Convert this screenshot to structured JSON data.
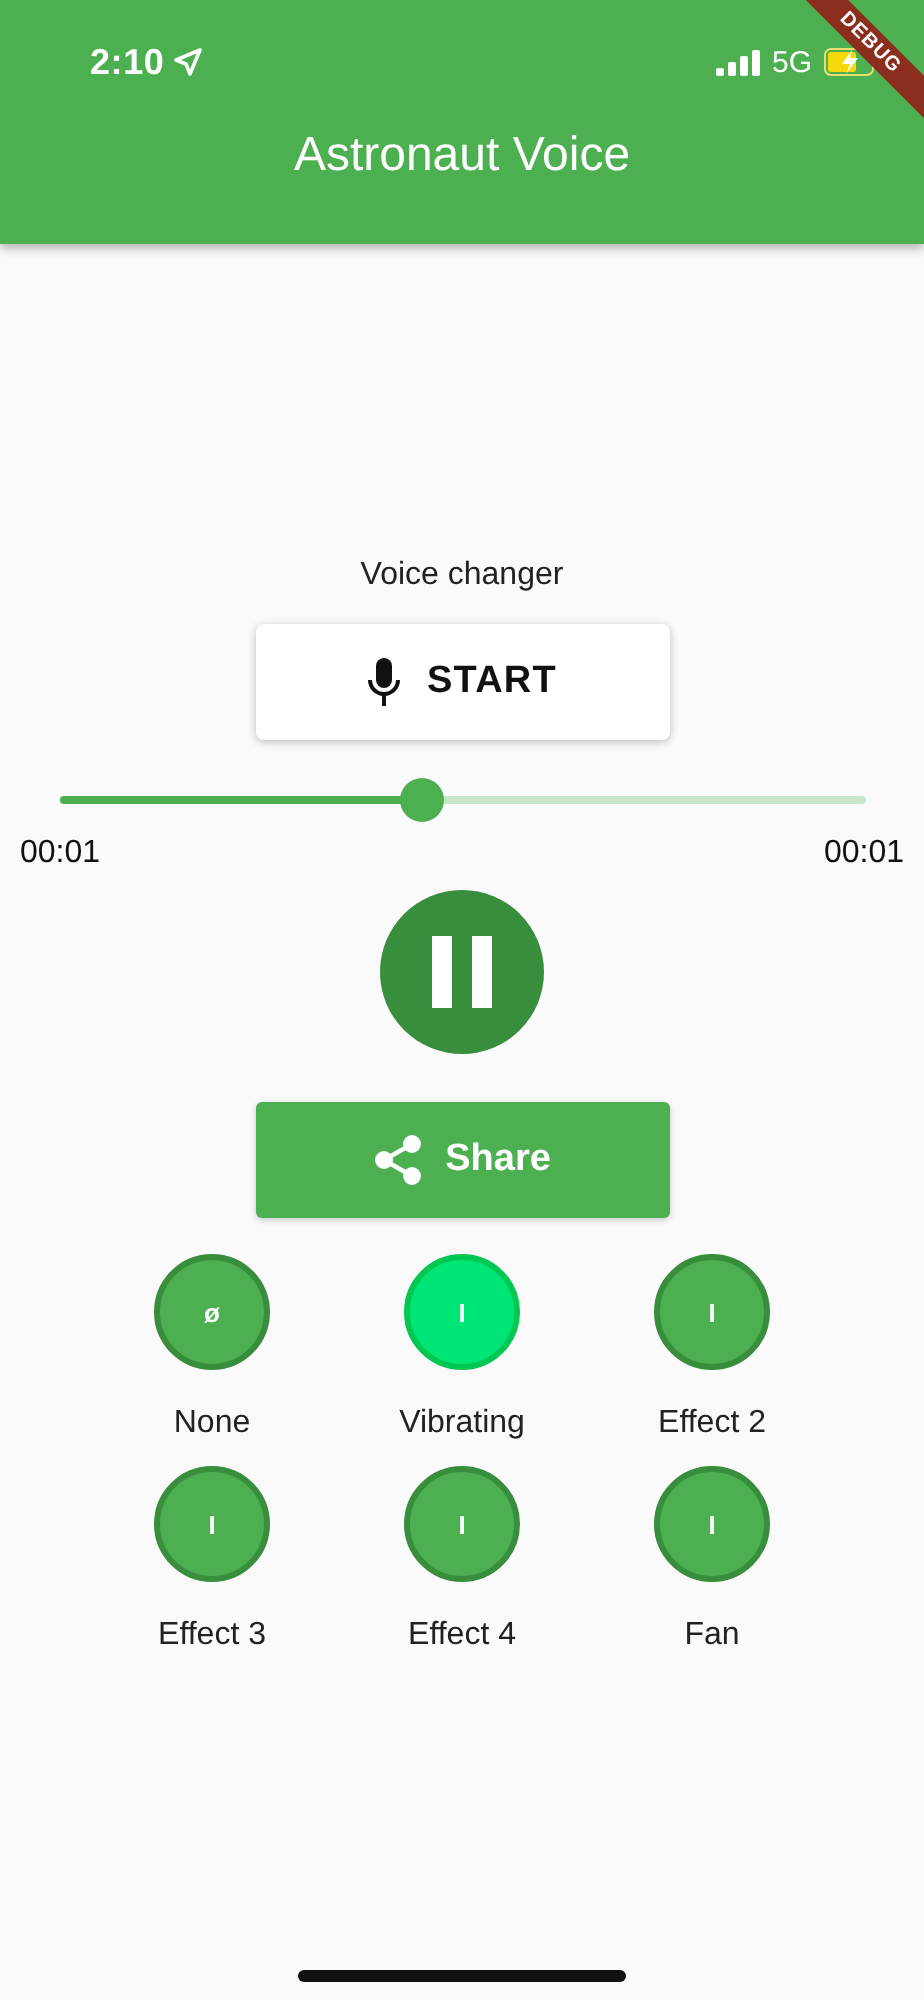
{
  "status_bar": {
    "time": "2:10",
    "network": "5G"
  },
  "debug_banner": "DEBUG",
  "app_bar": {
    "title": "Astronaut Voice"
  },
  "recorder": {
    "label": "Voice changer",
    "start_button": "START"
  },
  "player": {
    "level": 0.45,
    "elapsed": "00:01",
    "total": "00:01",
    "playing": true
  },
  "share_button": "Share",
  "effects": [
    {
      "glyph": "ø",
      "label": "None",
      "selected": false
    },
    {
      "glyph": "I",
      "label": "Vibrating",
      "selected": true
    },
    {
      "glyph": "I",
      "label": "Effect 2",
      "selected": false
    },
    {
      "glyph": "I",
      "label": "Effect 3",
      "selected": false
    },
    {
      "glyph": "I",
      "label": "Effect 4",
      "selected": false
    },
    {
      "glyph": "I",
      "label": "Fan",
      "selected": false
    }
  ]
}
